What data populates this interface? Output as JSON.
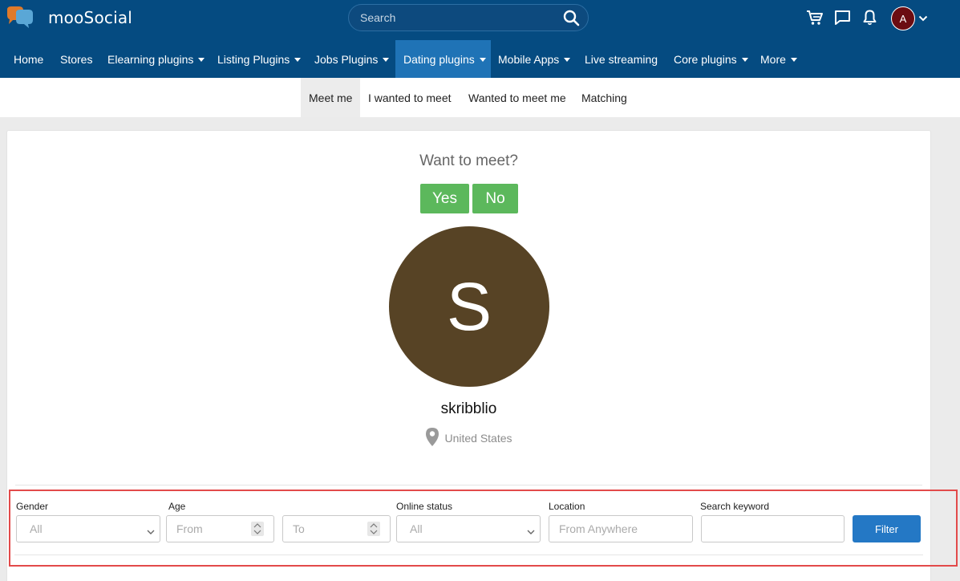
{
  "header": {
    "logo_text": "mooSocial",
    "search_placeholder": "Search",
    "user_initial": "A"
  },
  "nav": {
    "items": [
      {
        "label": "Home"
      },
      {
        "label": "Stores"
      },
      {
        "label": "Elearning plugins"
      },
      {
        "label": "Listing Plugins"
      },
      {
        "label": "Jobs Plugins"
      },
      {
        "label": "Dating plugins"
      },
      {
        "label": "Mobile Apps"
      },
      {
        "label": "Live streaming"
      },
      {
        "label": "Core plugins"
      },
      {
        "label": "More"
      }
    ]
  },
  "subnav": {
    "items": [
      {
        "label": "Meet me"
      },
      {
        "label": "I wanted to meet"
      },
      {
        "label": "Wanted to meet me"
      },
      {
        "label": "Matching"
      }
    ]
  },
  "meet": {
    "question": "Want to meet?",
    "yes_label": "Yes",
    "no_label": "No",
    "avatar_letter": "S",
    "username": "skribblio",
    "location": "United States"
  },
  "filter": {
    "gender_label": "Gender",
    "gender_value": "All",
    "age_label": "Age",
    "age_from_placeholder": "From",
    "age_to_placeholder": "To",
    "online_label": "Online status",
    "online_value": "All",
    "location_label": "Location",
    "location_placeholder": "From Anywhere",
    "keyword_label": "Search keyword",
    "keyword_value": "",
    "button_label": "Filter"
  },
  "colors": {
    "header_bg": "#054b81",
    "nav_active": "#1f73b6",
    "yes_no_green": "#5cb85c",
    "avatar_brown": "#574325",
    "filter_button": "#2478c5",
    "highlight_border": "#e24a4a"
  },
  "icons": [
    "moosocial-logo-icon",
    "search-icon",
    "cart-icon",
    "chat-icon",
    "bell-icon",
    "chevron-down-icon",
    "map-pin-icon"
  ]
}
